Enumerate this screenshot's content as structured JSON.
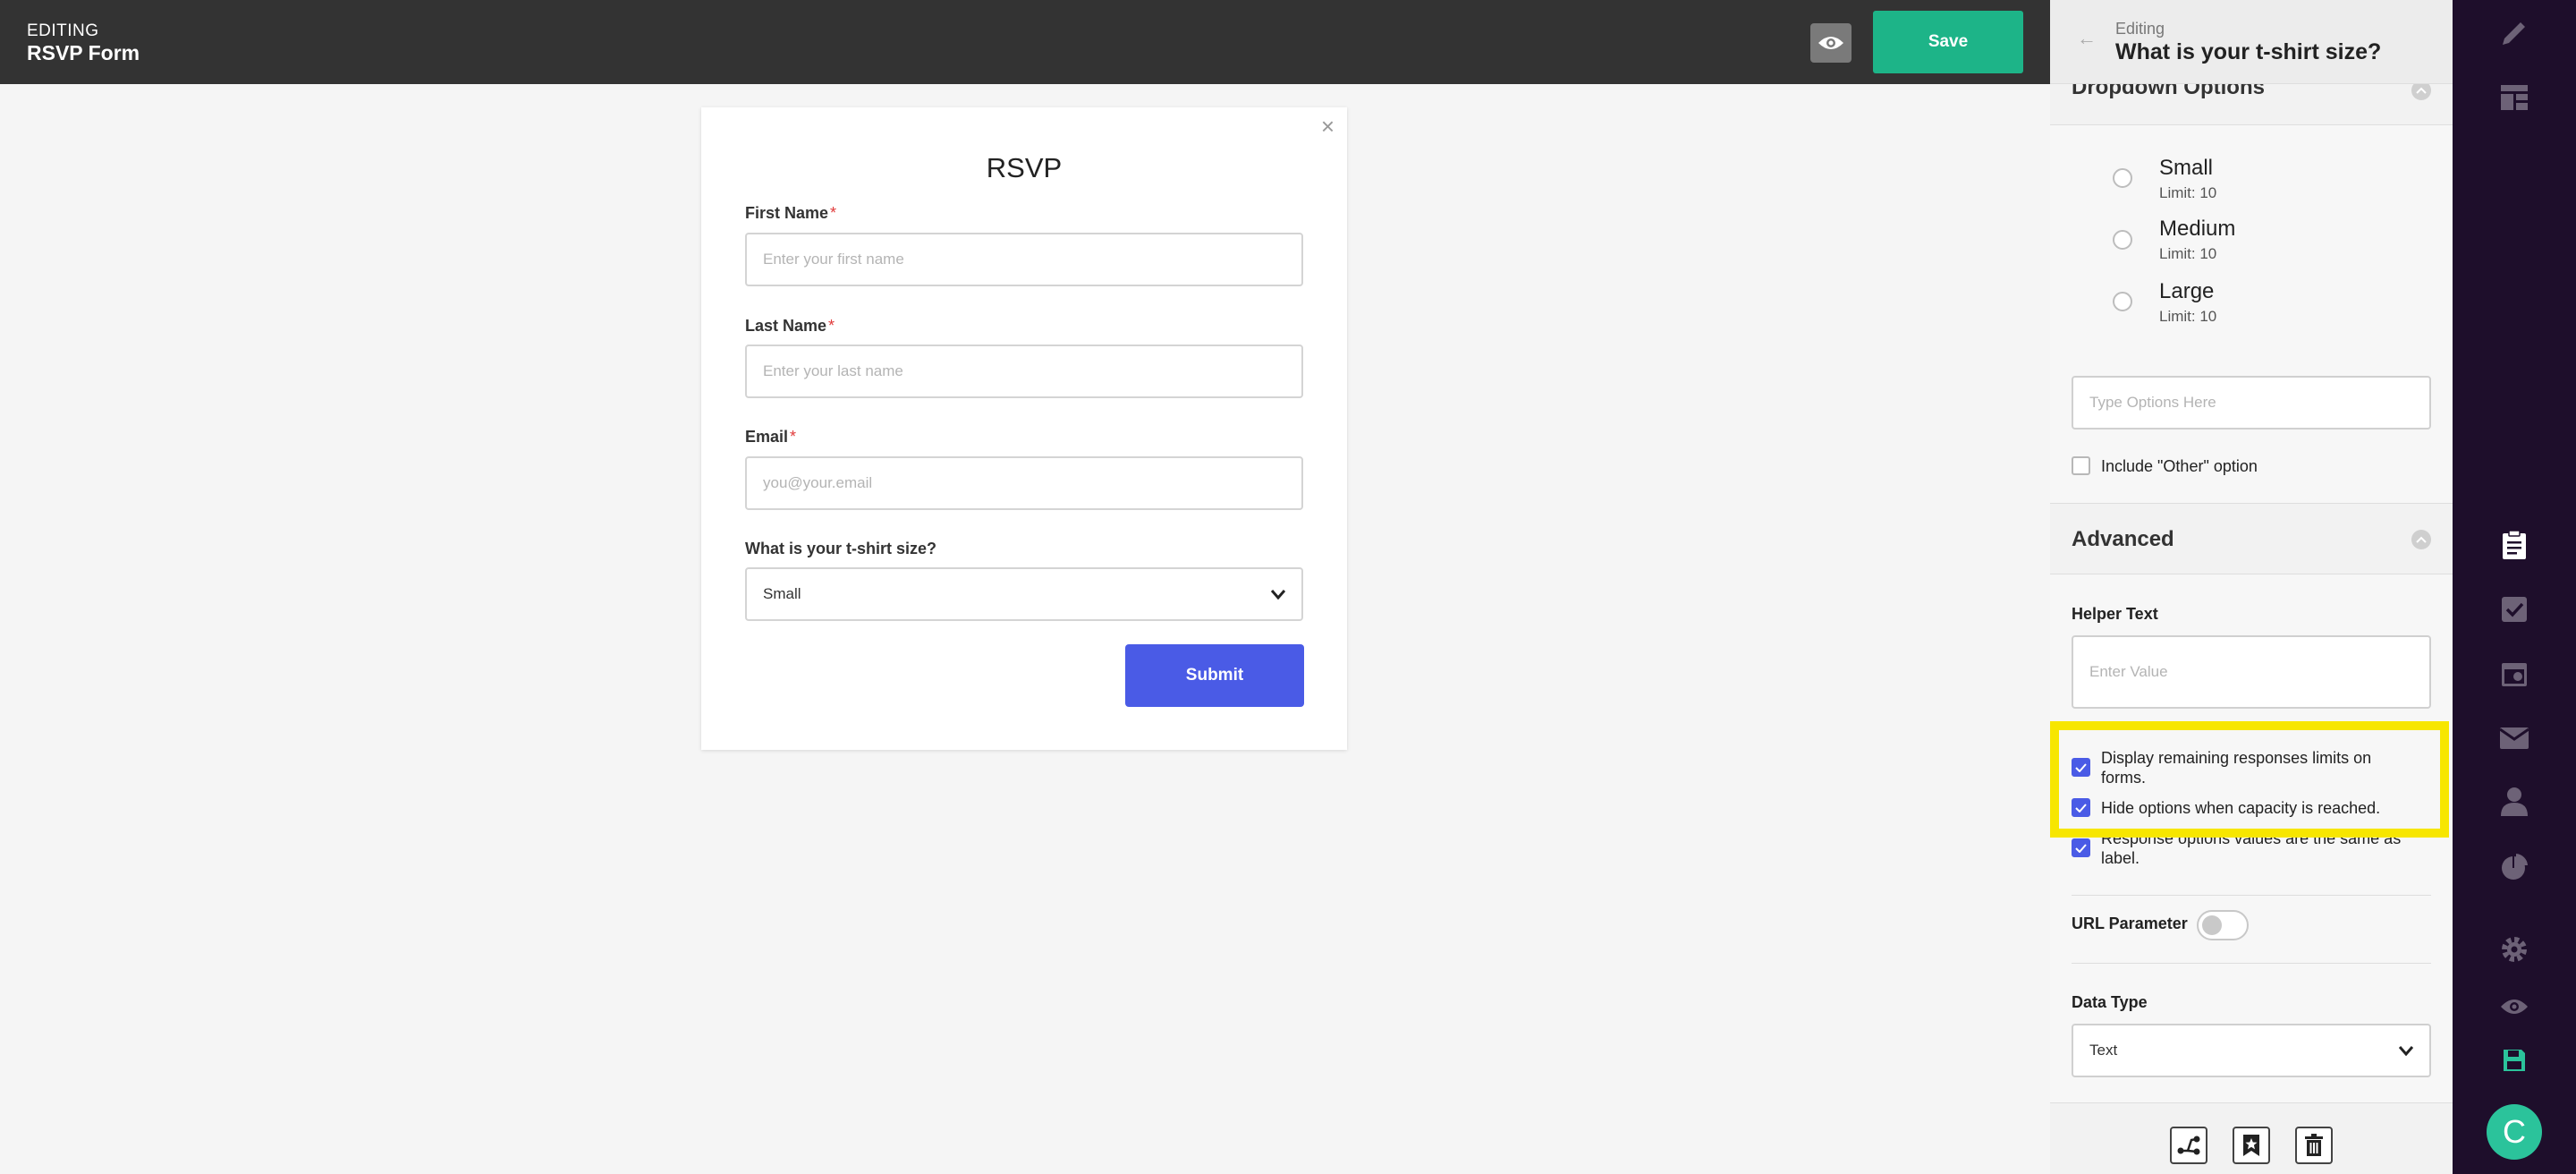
{
  "topbar": {
    "mode_label": "EDITING",
    "form_name": "RSVP Form",
    "save_label": "Save",
    "preview_icon": "eye-icon"
  },
  "form": {
    "title": "RSVP",
    "close_icon": "close-icon",
    "fields": {
      "first_name": {
        "label": "First Name",
        "required_mark": "*",
        "placeholder": "Enter your first name"
      },
      "last_name": {
        "label": "Last Name",
        "required_mark": "*",
        "placeholder": "Enter your last name"
      },
      "email": {
        "label": "Email",
        "required_mark": "*",
        "placeholder": "you@your.email"
      },
      "tshirt": {
        "label": "What is your t-shirt size?",
        "value": "Small"
      }
    },
    "submit_label": "Submit"
  },
  "panel": {
    "editing_label": "Editing",
    "title": "What is your t-shirt size?",
    "dropdown_section_title": "Dropdown Options",
    "options": [
      {
        "name": "Small",
        "limit": "Limit: 10"
      },
      {
        "name": "Medium",
        "limit": "Limit: 10"
      },
      {
        "name": "Large",
        "limit": "Limit: 10"
      }
    ],
    "type_options_placeholder": "Type Options Here",
    "include_other_label": "Include \"Other\" option",
    "advanced_title": "Advanced",
    "helper_text_label": "Helper Text",
    "helper_text_placeholder": "Enter Value",
    "checkboxes": {
      "display_remaining": "Display remaining responses limits on forms.",
      "hide_options": "Hide options when capacity is reached.",
      "same_as_label": "Response options values are the same as label."
    },
    "url_parameter_label": "URL Parameter",
    "data_type_label": "Data Type",
    "data_type_value": "Text"
  },
  "rail": {
    "chat_letter": "C"
  },
  "colors": {
    "topbar": "#333333",
    "save": "#1db488",
    "submit": "#4a5be6",
    "rail": "#1e0e2b",
    "highlight": "#f7e600",
    "rail_active": "#2bc39b"
  }
}
